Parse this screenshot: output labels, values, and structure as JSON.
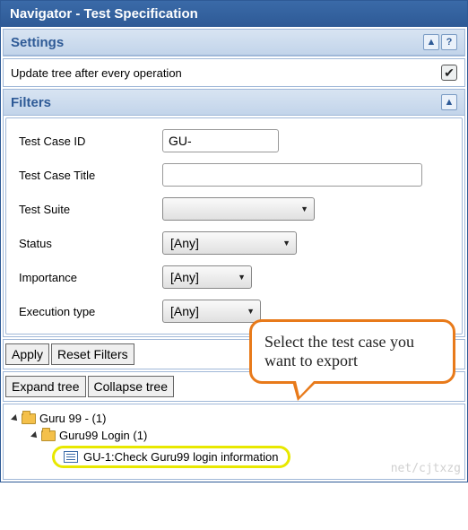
{
  "titlebar": {
    "text": "Navigator - Test Specification"
  },
  "settings": {
    "header": "Settings",
    "row_label": "Update tree after every operation",
    "checked_glyph": "✔"
  },
  "filters": {
    "header": "Filters",
    "fields": {
      "test_case_id": {
        "label": "Test Case ID",
        "value": "GU-"
      },
      "test_case_title": {
        "label": "Test Case Title",
        "value": ""
      },
      "test_suite": {
        "label": "Test Suite",
        "selected": ""
      },
      "status": {
        "label": "Status",
        "selected": "[Any]"
      },
      "importance": {
        "label": "Importance",
        "selected": "[Any]"
      },
      "execution_type": {
        "label": "Execution type",
        "selected": "[Any]"
      }
    },
    "buttons": {
      "apply": "Apply",
      "reset": "Reset Filters"
    }
  },
  "tree_controls": {
    "expand": "Expand tree",
    "collapse": "Collapse tree"
  },
  "tree": {
    "root_label": "Guru 99 - (1)",
    "child_label": "Guru99 Login (1)",
    "leaf_label": "GU-1:Check Guru99 login information"
  },
  "callout": {
    "text": "Select the test case you want to export"
  },
  "icons": {
    "collapse": "▲",
    "help": "?"
  },
  "watermark": "net/cjtxzg"
}
